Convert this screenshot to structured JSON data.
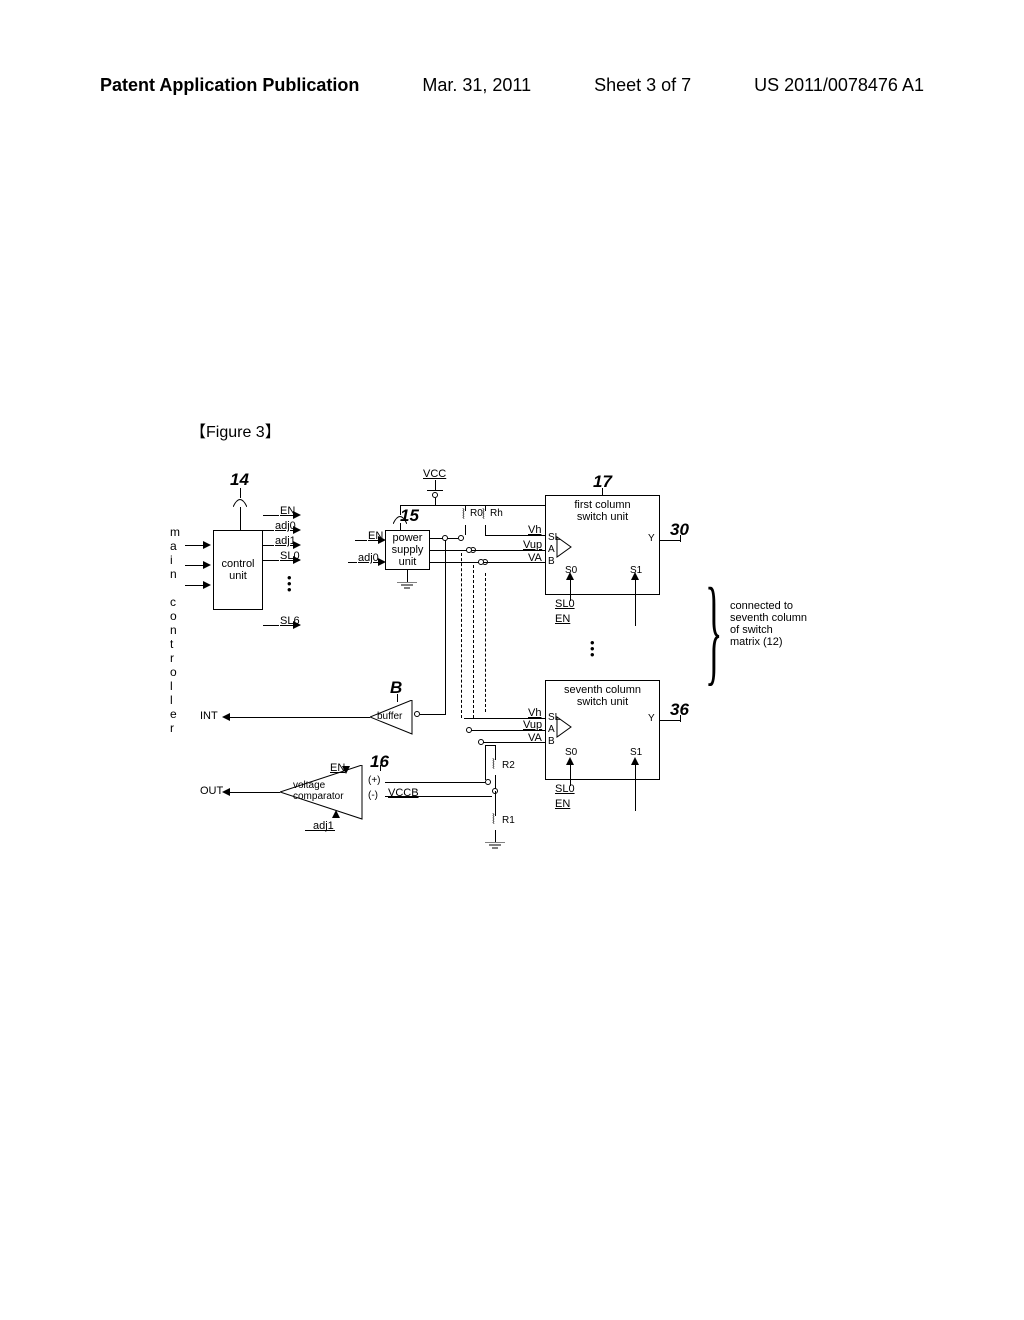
{
  "header": {
    "left": "Patent Application Publication",
    "date": "Mar. 31, 2011",
    "sheet": "Sheet 3 of 7",
    "pubno": "US 2011/0078476 A1"
  },
  "figure_label": "【Figure 3】",
  "blocks": {
    "control_unit": "control\nunit",
    "power_supply": "power\nsupply\nunit",
    "voltage_comparator": "voltage\ncomparator",
    "buffer": "buffer",
    "first_switch": "first column\nswitch unit",
    "seventh_switch": "seventh column\nswitch unit"
  },
  "refs": {
    "r14": "14",
    "r15": "15",
    "r16": "16",
    "r17": "17",
    "r30": "30",
    "r36": "36",
    "rB": "B"
  },
  "signals": {
    "VCC": "VCC",
    "EN": "EN",
    "adj0": "adj0",
    "adj1": "adj1",
    "SL0": "SL0",
    "SL6": "SL6",
    "INT": "INT",
    "OUT": "OUT",
    "VCCB": "VCCB",
    "Vh": "Vh",
    "Vup": "Vup",
    "VA": "VA",
    "SL": "SL",
    "A": "A",
    "B": "B",
    "Y": "Y",
    "S0": "S0",
    "S1": "S1",
    "R0": "R0",
    "Rh": "Rh",
    "R1": "R1",
    "R2": "R2",
    "plus": "(+)",
    "minus": "(-)"
  },
  "side_text": {
    "main_controller": "main controller",
    "connected_right": "connected to\nseventh column\nof switch\nmatrix (12)"
  }
}
